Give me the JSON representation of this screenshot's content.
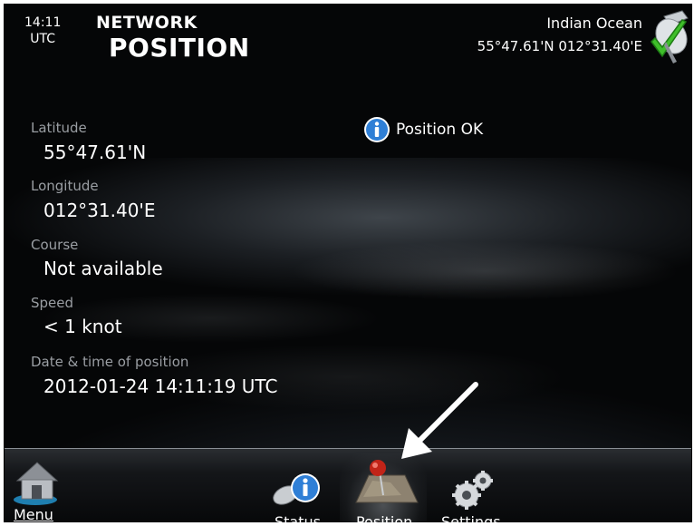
{
  "header": {
    "time": "14:11",
    "timezone": "UTC",
    "title_small": "NETWORK",
    "title_big": "POSITION",
    "region": "Indian Ocean",
    "coords": "55°47.61'N  012°31.40'E"
  },
  "fields": [
    {
      "label": "Latitude",
      "value": "55°47.61'N"
    },
    {
      "label": "Longitude",
      "value": "012°31.40'E"
    },
    {
      "label": "Course",
      "value": "Not available"
    },
    {
      "label": "Speed",
      "value": "< 1 knot"
    },
    {
      "label": "Date & time of position",
      "value": "2012-01-24 14:11:19 UTC"
    }
  ],
  "status": {
    "text": "Position OK",
    "icon": "info-icon"
  },
  "nav": {
    "menu": "Menu",
    "status": "Status",
    "position": "Position",
    "settings": "Settings"
  },
  "colors": {
    "label": "#9a9ea3",
    "text": "#ffffff",
    "info_blue": "#2f7fd6"
  }
}
